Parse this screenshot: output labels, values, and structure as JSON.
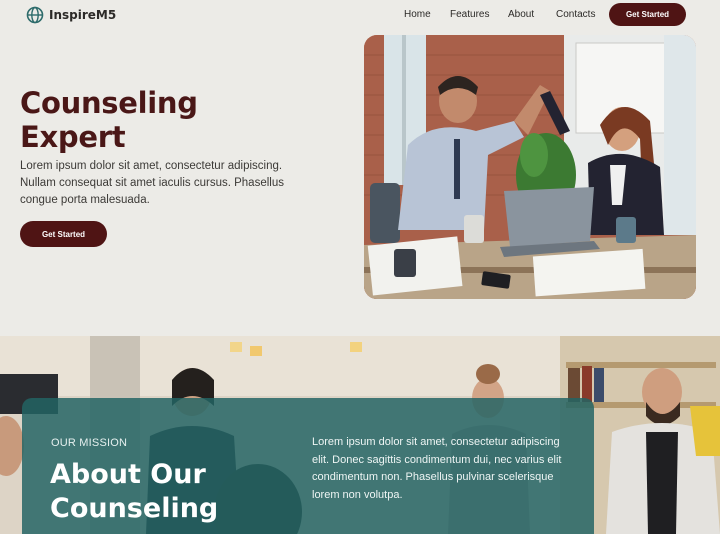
{
  "nav": {
    "brand": "InspireM5",
    "brand_icon": "globe-icon",
    "links": [
      "Home",
      "Features",
      "About",
      "Contacts"
    ],
    "cta_label": "Get Started"
  },
  "hero": {
    "title_line1": "Counseling",
    "title_line2": "Expert",
    "description": "Lorem ipsum dolor sit amet, consectetur adipiscing. Nullam consequat sit amet iaculis cursus. Phasellus congue porta malesuada.",
    "cta_label": "Get Started",
    "photo": "two-people-high-five-at-office-desk"
  },
  "mission": {
    "kicker": "OUR MISSION",
    "title_line1": "About Our",
    "title_line2": "Counseling",
    "description": "Lorem ipsum dolor sit amet, consectetur adipiscing elit. Donec sagittis condimentum dui, nec varius elit condimentum non. Phasellus pulvinar scelerisque lorem non volutpa.",
    "photo": "group-meeting-in-office"
  },
  "colors": {
    "background": "#ecebe7",
    "accent": "#4f1414",
    "title": "#4a1717",
    "teal_panel": "#226464"
  }
}
